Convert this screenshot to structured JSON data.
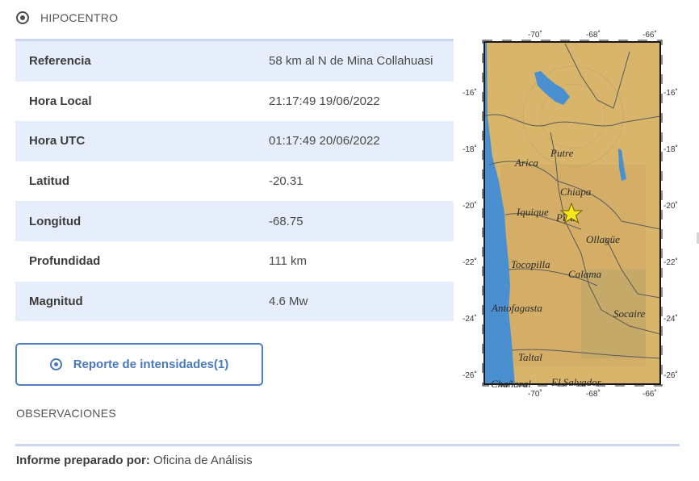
{
  "header": {
    "title": "HIPOCENTRO",
    "icon": "target-icon"
  },
  "table": {
    "rows": [
      {
        "label": "Referencia",
        "value": "58 km al N de Mina Collahuasi"
      },
      {
        "label": "Hora Local",
        "value": "21:17:49 19/06/2022"
      },
      {
        "label": "Hora UTC",
        "value": "01:17:49 20/06/2022"
      },
      {
        "label": "Latitud",
        "value": "-20.31"
      },
      {
        "label": "Longitud",
        "value": "-68.75"
      },
      {
        "label": "Profundidad",
        "value": "111 km"
      },
      {
        "label": "Magnitud",
        "value": "4.6 Mw"
      }
    ]
  },
  "intensity_button": {
    "label": "Reporte de intensidades(1)",
    "icon": "target-icon"
  },
  "observations_title": "OBSERVACIONES",
  "prepared_by": {
    "label": "Informe preparado por:",
    "value": "Oficina de Análisis"
  },
  "map": {
    "lon_ticks": [
      "-70˚",
      "-68˚",
      "-66˚"
    ],
    "lat_ticks": [
      "-16˚",
      "-18˚",
      "-20˚",
      "-22˚",
      "-24˚",
      "-26˚"
    ],
    "places": [
      "Arica",
      "Putre",
      "Chiapa",
      "Iquique",
      "Pica",
      "Ollagüe",
      "Tocopilla",
      "Calama",
      "Antofagasta",
      "Socaire",
      "Taltal",
      "Chañaral",
      "El Salvador"
    ],
    "epicenter_marker": "star-icon",
    "colors": {
      "ocean": "#4a90d0",
      "land": "#d9b56c",
      "star": "#f3e61a",
      "accent": "#4e7fc2"
    }
  }
}
